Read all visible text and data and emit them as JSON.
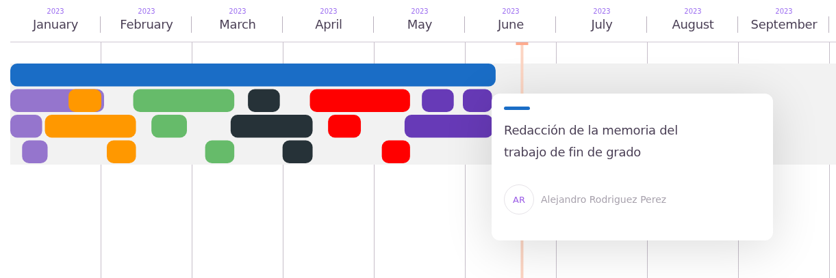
{
  "months": [
    {
      "year": "2023",
      "name": "January"
    },
    {
      "year": "2023",
      "name": "February"
    },
    {
      "year": "2023",
      "name": "March"
    },
    {
      "year": "2023",
      "name": "April"
    },
    {
      "year": "2023",
      "name": "May"
    },
    {
      "year": "2023",
      "name": "June"
    },
    {
      "year": "2023",
      "name": "July"
    },
    {
      "year": "2023",
      "name": "August"
    },
    {
      "year": "2023",
      "name": "September"
    }
  ],
  "lanes": [
    {
      "bars": [
        {
          "color": "#1a6dc6"
        }
      ]
    },
    {
      "bars": [
        {
          "color": "#9575cd"
        },
        {
          "color": "#ff9800"
        },
        {
          "color": "#66bb6a"
        },
        {
          "color": "#263238"
        },
        {
          "color": "#ff0000"
        },
        {
          "color": "#673ab7"
        },
        {
          "color": "#673ab7"
        }
      ]
    },
    {
      "bars": [
        {
          "color": "#9575cd"
        },
        {
          "color": "#ff9800"
        },
        {
          "color": "#66bb6a"
        },
        {
          "color": "#263238"
        },
        {
          "color": "#ff0000"
        },
        {
          "color": "#673ab7"
        }
      ]
    },
    {
      "bars": [
        {
          "color": "#9575cd"
        },
        {
          "color": "#ff9800"
        },
        {
          "color": "#66bb6a"
        },
        {
          "color": "#263238"
        },
        {
          "color": "#ff0000"
        }
      ]
    }
  ],
  "tooltip": {
    "color": "#1a6dc6",
    "title": "Redacción de la memoria del trabajo de fin de grado",
    "initials": "AR",
    "assignee": "Alejandro Rodriguez Perez"
  }
}
